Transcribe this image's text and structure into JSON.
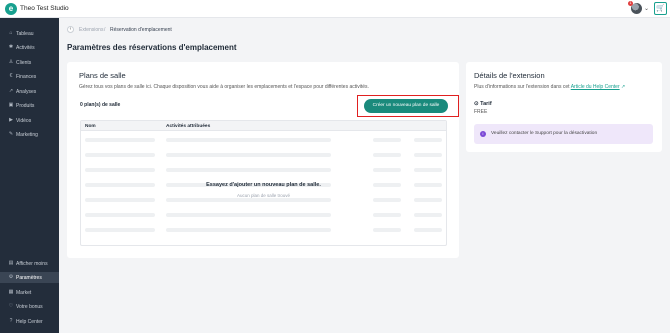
{
  "app": {
    "studio_name": "Theo Test Studio",
    "notification_count": "1"
  },
  "sidebar": {
    "top_items": [
      {
        "label": "Tableau",
        "icon": "home-icon"
      },
      {
        "label": "Activités",
        "icon": "activity-icon"
      },
      {
        "label": "Clients",
        "icon": "user-icon"
      },
      {
        "label": "Finances",
        "icon": "currency-icon"
      },
      {
        "label": "Analyses",
        "icon": "chart-icon"
      },
      {
        "label": "Produits",
        "icon": "box-icon"
      },
      {
        "label": "Vidéos",
        "icon": "play-icon"
      },
      {
        "label": "Marketing",
        "icon": "megaphone-icon"
      }
    ],
    "bottom_items": [
      {
        "label": "Afficher moins",
        "icon": "collapse-icon"
      },
      {
        "label": "Paramètres",
        "icon": "gear-icon",
        "active": true
      },
      {
        "label": "Market",
        "icon": "store-icon"
      },
      {
        "label": "Votre bonus",
        "icon": "heart-icon"
      },
      {
        "label": "Help Center",
        "icon": "help-icon"
      }
    ]
  },
  "breadcrumb": {
    "parent": "Extensions",
    "separator": "/",
    "current": "Réservation d'emplacement"
  },
  "page": {
    "title": "Paramètres des réservations d'emplacement"
  },
  "floor_plans": {
    "title": "Plans de salle",
    "description": "Gérez tous vos plans de salle ici. Chaque disposition vous aide à organiser les emplacements et l'espace pour différentes activités.",
    "count_text": "0 plan(s) de salle",
    "create_button": "Créer un nouveau plan de salle",
    "columns": [
      "Nom",
      "Activités attribuées"
    ],
    "empty_title": "Essayez d'ajouter un nouveau plan de salle.",
    "empty_subtitle": "Aucun plan de salle trouvé"
  },
  "extension_details": {
    "title": "Détails de l'extension",
    "info_prefix": "Plus d'informations sur l'extension dans cet",
    "help_link": "Article du Help Center",
    "tarif_label": "Tarif",
    "tarif_value": "FREE",
    "alert_text": "Veuillez contacter le Support pour la désactivation"
  },
  "colors": {
    "accent": "#17a08f",
    "button": "#1a8a7c",
    "sidebar": "#232d3b",
    "highlight": "#e02020",
    "alert_bg": "#efe7fa"
  }
}
